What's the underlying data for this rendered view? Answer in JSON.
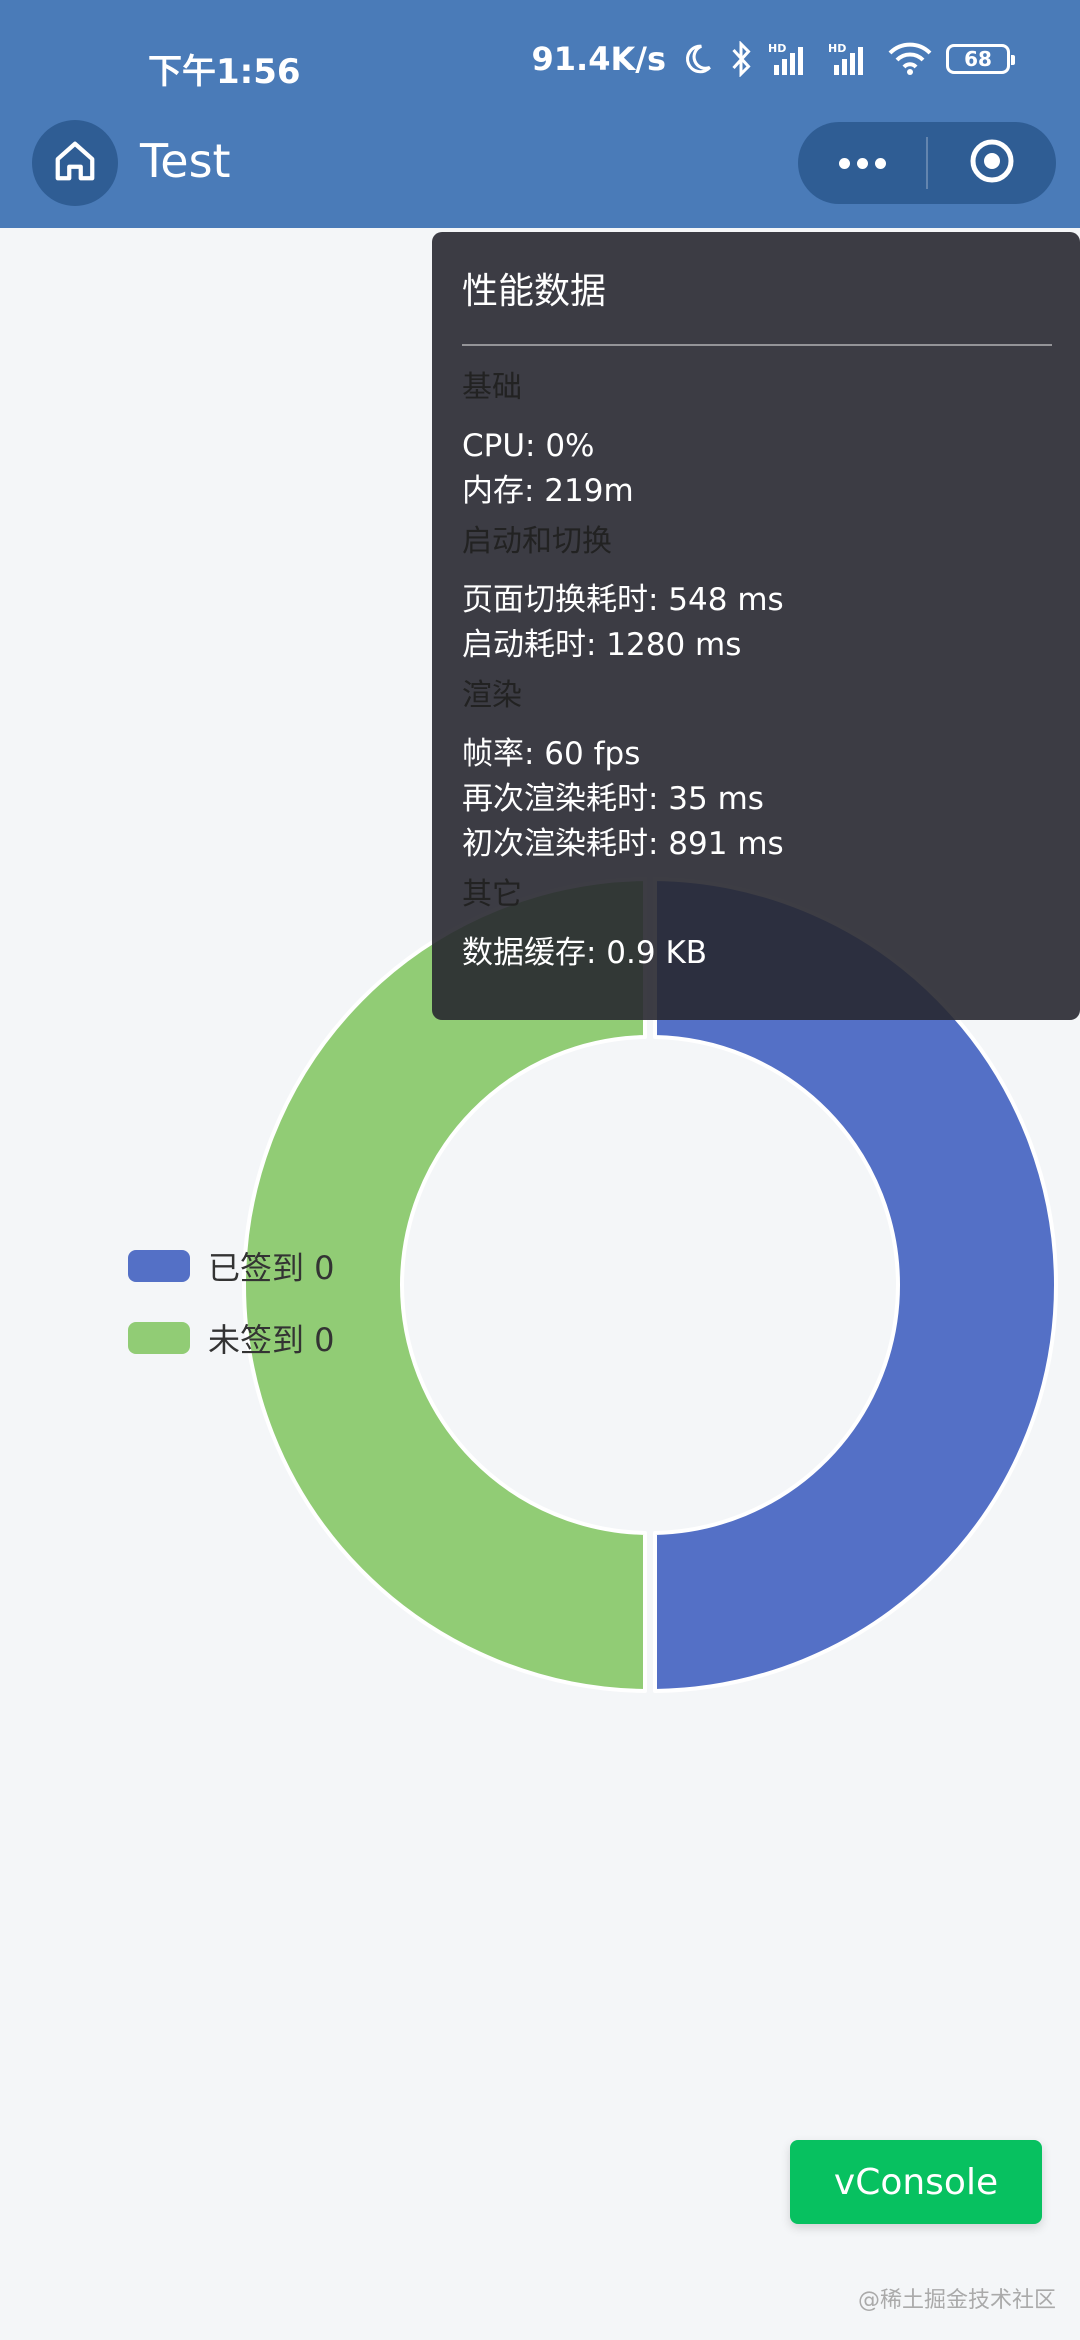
{
  "status_bar": {
    "time": "下午1:56",
    "net_speed": "91.4K/s",
    "battery": "68",
    "icons": [
      "moon-icon",
      "bluetooth-icon",
      "hd-signal-icon",
      "hd-signal-icon",
      "wifi-icon",
      "battery-icon"
    ]
  },
  "nav": {
    "title": "Test",
    "icons": [
      "home-icon",
      "more-icon",
      "target-icon"
    ]
  },
  "chart_data": {
    "type": "pie",
    "categories": [
      "已签到 0",
      "未签到 0"
    ],
    "values": [
      1,
      1
    ],
    "colors": [
      "#5470c6",
      "#91cc75"
    ],
    "legend": "left"
  },
  "legend": {
    "items": [
      {
        "label": "已签到 0",
        "color": "#5470c6"
      },
      {
        "label": "未签到 0",
        "color": "#91cc75"
      }
    ]
  },
  "perf": {
    "title": "性能数据",
    "sections": [
      {
        "name": "基础",
        "lines": [
          "CPU: 0%",
          "内存: 219m"
        ]
      },
      {
        "name": "启动和切换",
        "lines": [
          "页面切换耗时: 548 ms",
          "启动耗时: 1280 ms"
        ]
      },
      {
        "name": "渲染",
        "lines": [
          "帧率: 60 fps",
          "再次渲染耗时: 35 ms",
          "初次渲染耗时: 891 ms"
        ]
      },
      {
        "name": "其它",
        "lines": [
          "数据缓存: 0.9 KB"
        ]
      }
    ]
  },
  "vconsole": {
    "label": "vConsole"
  },
  "watermark": "@稀土掘金技术社区"
}
